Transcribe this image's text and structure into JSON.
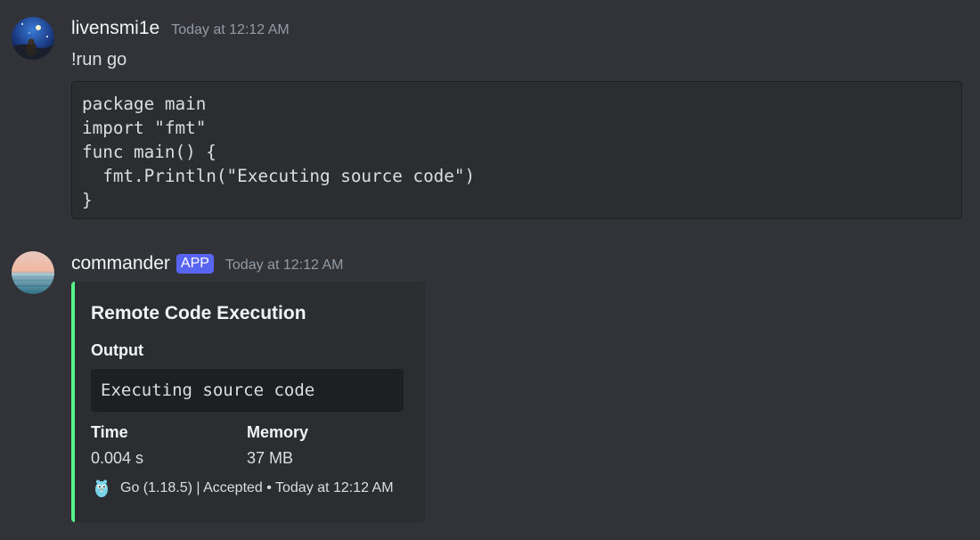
{
  "colors": {
    "background": "#313338",
    "embed_accent": "#57f287",
    "app_badge": "#5865f2"
  },
  "messages": [
    {
      "avatar_icon": "night-sky-avatar-icon",
      "username": "livensmi1e",
      "timestamp": "Today at 12:12 AM",
      "text": "!run go",
      "code_lines": [
        "package main",
        "import \"fmt\"",
        "func main() {",
        "  fmt.Println(\"Executing source code\")",
        "}"
      ]
    },
    {
      "avatar_icon": "sunset-sea-avatar-icon",
      "username": "commander",
      "badge": "APP",
      "timestamp": "Today at 12:12 AM",
      "embed": {
        "title": "Remote Code Execution",
        "output_label": "Output",
        "output_value": "Executing source code",
        "fields": [
          {
            "name": "Time",
            "value": "0.004 s"
          },
          {
            "name": "Memory",
            "value": "37 MB"
          }
        ],
        "footer_icon": "go-gopher-icon",
        "footer_text": "Go (1.18.5) | Accepted • Today at 12:12 AM"
      }
    }
  ]
}
